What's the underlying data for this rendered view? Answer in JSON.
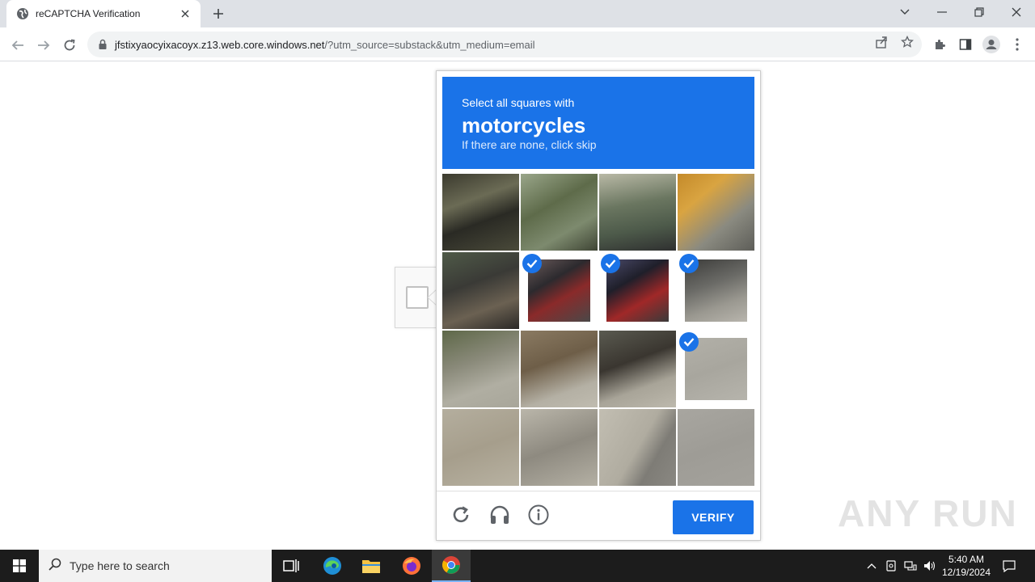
{
  "browser": {
    "tab_title": "reCAPTCHA Verification",
    "url_host": "jfstixyaocyixacoyx.z13.web.core.windows.net",
    "url_rest": "/?utm_source=substack&utm_medium=email"
  },
  "challenge": {
    "line1": "Select all squares with",
    "line2": "motorcycles",
    "line3": "If there are none, click skip",
    "verify_label": "VERIFY",
    "tiles": [
      {
        "selected": false,
        "style": "linear-gradient(160deg,#3b3a2e 0%,#6b6b55 35%,#2a2a24 60%,#4a4a3a 100%)"
      },
      {
        "selected": false,
        "style": "linear-gradient(150deg,#9aa68a 0%,#5e6b4a 40%,#7d8a6e 70%,#3e4434 100%)"
      },
      {
        "selected": false,
        "style": "linear-gradient(170deg,#b9b9a6 0%,#6a7660 40%,#4d5a4a 70%,#2f3030 100%)"
      },
      {
        "selected": false,
        "style": "linear-gradient(140deg,#c48a2a 0%,#d9a441 30%,#8a8a80 65%,#5d5d58 100%)"
      },
      {
        "selected": false,
        "style": "linear-gradient(160deg,#4f5a48 0%,#3a3a36 40%,#6b6152 70%,#2a2826 100%)"
      },
      {
        "selected": true,
        "style": "linear-gradient(150deg,#6a5a5a 0%,#2c2a2e 35%,#8a2a2a 60%,#4a4848 100%)"
      },
      {
        "selected": true,
        "style": "linear-gradient(150deg,#4a4a6a 0%,#1f1f2a 35%,#a02828 65%,#3a3a3a 100%)"
      },
      {
        "selected": true,
        "style": "linear-gradient(160deg,#3c3c3a 0%,#6a6a66 40%,#9a9890 70%,#b8b5ad 100%)"
      },
      {
        "selected": false,
        "style": "linear-gradient(160deg,#5e6848 0%,#8a8a7a 40%,#b0aea2 70%,#a8a69a 100%)"
      },
      {
        "selected": false,
        "style": "linear-gradient(160deg,#8a7a62 0%,#6e5e48 40%,#b4b0a4 75%,#c0bcb0 100%)"
      },
      {
        "selected": false,
        "style": "linear-gradient(160deg,#5a5a50 0%,#3a3630 40%,#a8a498 70%,#bdb9ad 100%)"
      },
      {
        "selected": true,
        "style": "linear-gradient(160deg,#b2b0a8 0%,#a8a69e 50%,#b6b4ac 100%)"
      },
      {
        "selected": false,
        "style": "linear-gradient(160deg,#b4ae9e 0%,#a69e8c 50%,#b8b2a2 100%)"
      },
      {
        "selected": false,
        "style": "linear-gradient(160deg,#bab6aa 0%,#8e8a80 50%,#b4b0a4 100%)"
      },
      {
        "selected": false,
        "style": "linear-gradient(120deg,#c2beb2 0%,#b0aca0 50%,#7e7c76 70%,#8a8882 100%)"
      },
      {
        "selected": false,
        "style": "linear-gradient(160deg,#a8a6a0 0%,#9e9c96 50%,#a4a29c 100%)"
      }
    ]
  },
  "watermark": "ANY RUN",
  "taskbar": {
    "search_placeholder": "Type here to search",
    "time": "5:40 AM",
    "date": "12/19/2024"
  },
  "icons": {
    "favicon": "globe-icon",
    "tab_close": "close-icon",
    "new_tab": "plus-icon",
    "back": "arrow-left-icon",
    "forward": "arrow-right-icon",
    "reload": "reload-icon",
    "lock": "lock-icon",
    "share": "share-icon",
    "bookmark": "star-icon",
    "extensions": "puzzle-icon",
    "sidepanel": "sidepanel-icon",
    "profile": "avatar-icon",
    "menu": "kebab-menu-icon",
    "refresh": "refresh-icon",
    "audio": "headphones-icon",
    "info": "info-icon"
  }
}
